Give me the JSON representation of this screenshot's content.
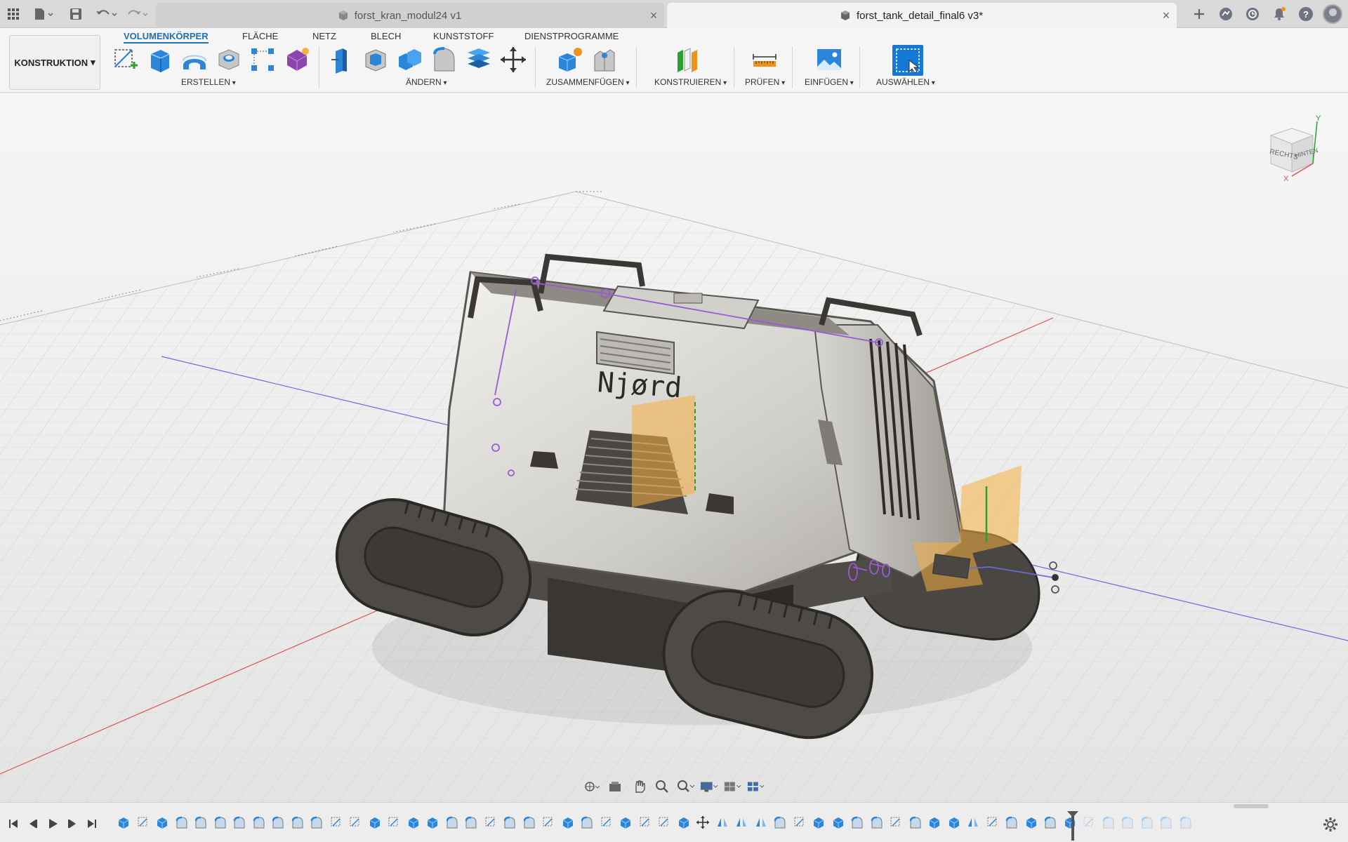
{
  "tabs": [
    {
      "label": "forst_kran_modul24 v1",
      "active": false
    },
    {
      "label": "forst_tank_detail_final6 v3*",
      "active": true
    }
  ],
  "tab_close": "×",
  "workspace": {
    "label": "KONSTRUKTION",
    "arrow": "▾"
  },
  "ribbon_tabs": [
    "VOLUMENKÖRPER",
    "FLÄCHE",
    "NETZ",
    "BLECH",
    "KUNSTSTOFF",
    "DIENSTPROGRAMME"
  ],
  "groups": {
    "create": "ERSTELLEN",
    "modify": "ÄNDERN",
    "assemble": "ZUSAMMENFÜGEN",
    "construct": "KONSTRUIEREN",
    "inspect": "PRÜFEN",
    "insert": "EINFÜGEN",
    "select": "AUSWÄHLEN"
  },
  "viewcube": {
    "face_right": "RECHTS",
    "face_back": "HINTEN",
    "axis_y": "Y",
    "axis_x": "X"
  },
  "model": {
    "logo": "Njørd"
  },
  "help_label": "?",
  "colors": {
    "accent": "#1f6fb5",
    "grid_red": "#e05050",
    "grid_blue": "#6a6ad8",
    "sketch_purple": "#9b59d6",
    "plane_orange": "#f5b041"
  },
  "icons": [
    "apps-grid-icon",
    "file-icon",
    "save-icon",
    "undo-icon",
    "redo-icon",
    "new-tab-icon",
    "online-status-icon",
    "job-status-icon",
    "notifications-icon",
    "help-icon",
    "user-avatar"
  ]
}
